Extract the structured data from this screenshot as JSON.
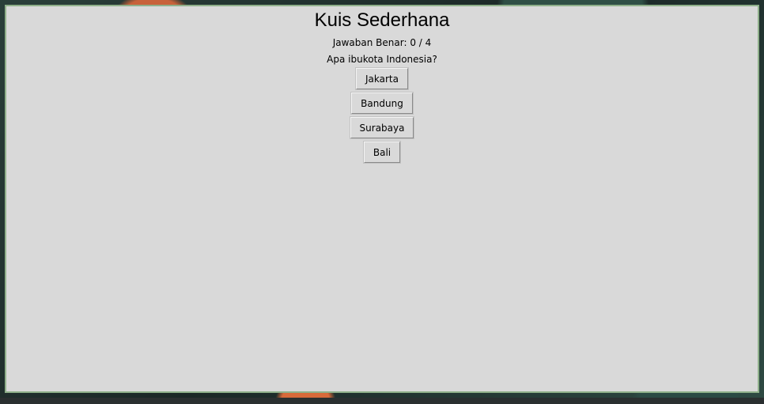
{
  "window": {
    "title": "Kuis Sederhana"
  },
  "quiz": {
    "score_text": "Jawaban Benar: 0 / 4",
    "question": "Apa ibukota Indonesia?",
    "options": [
      "Jakarta",
      "Bandung",
      "Surabaya",
      "Bali"
    ]
  },
  "colors": {
    "window_background": "#d9d9d9",
    "window_border": "#8fb08a"
  }
}
